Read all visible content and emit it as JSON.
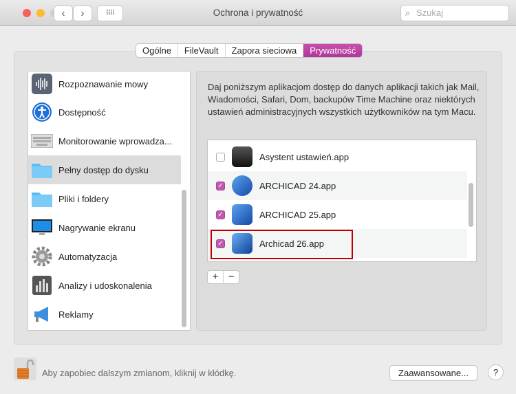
{
  "window": {
    "title": "Ochrona i prywatność",
    "search_placeholder": "Szukaj"
  },
  "tabs": [
    {
      "label": "Ogólne"
    },
    {
      "label": "FileVault"
    },
    {
      "label": "Zapora sieciowa"
    },
    {
      "label": "Prywatność",
      "active": true
    }
  ],
  "sidebar": {
    "items": [
      {
        "label": "Rozpoznawanie mowy",
        "icon": "waveform-icon"
      },
      {
        "label": "Dostępność",
        "icon": "accessibility-icon"
      },
      {
        "label": "Monitorowanie wprowadza...",
        "icon": "keyboard-icon"
      },
      {
        "label": "Pełny dostęp do dysku",
        "icon": "folder-icon",
        "selected": true
      },
      {
        "label": "Pliki i foldery",
        "icon": "folder-icon"
      },
      {
        "label": "Nagrywanie ekranu",
        "icon": "display-icon"
      },
      {
        "label": "Automatyzacja",
        "icon": "gear-icon"
      },
      {
        "label": "Analizy i udoskonalenia",
        "icon": "chart-icon"
      },
      {
        "label": "Reklamy",
        "icon": "megaphone-icon"
      }
    ]
  },
  "main": {
    "description": "Daj poniższym aplikacjom dostęp do danych aplikacji takich jak Mail, Wiadomości, Safari, Dom, backupów Time Machine oraz niektórych ustawień administracyjnych wszystkich użytkowników na tym Macu.",
    "apps": [
      {
        "name": "Asystent ustawień.app",
        "checked": false
      },
      {
        "name": "ARCHICAD 24.app",
        "checked": true
      },
      {
        "name": "ARCHICAD 25.app",
        "checked": true
      },
      {
        "name": "Archicad 26.app",
        "checked": true
      }
    ],
    "add_label": "+",
    "remove_label": "−"
  },
  "footer": {
    "lock_text": "Aby zapobiec dalszym zmianom, kliknij w kłódkę.",
    "advanced_label": "Zaawansowane...",
    "help_label": "?"
  },
  "colors": {
    "accent": "#b93fa2",
    "highlight": "#c00000"
  }
}
